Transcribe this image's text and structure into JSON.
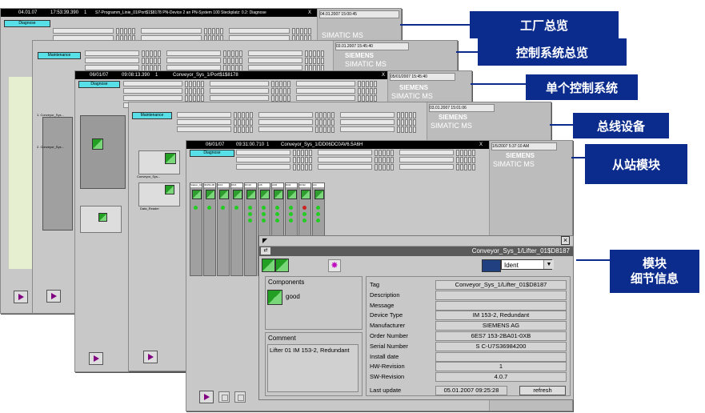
{
  "win1": {
    "titlebar": [
      "04.01.07",
      "17:53:39.390",
      "1",
      "S7-Programm_Linie_01/Port$1$8178 PN-Device 2 an PN-System 100 Steckplatz: 0.2: Diagnose",
      "X"
    ],
    "cyan_label": "Diagnose",
    "date": "04.01.2007 15:00:45",
    "simatic": "SIMATIC MS"
  },
  "win2": {
    "cyan_label": "Maintenance",
    "date": "03.01.2007 15:45:40",
    "siemens": "SIEMENS",
    "simatic": "SIMATIC MS",
    "module_labels": [
      "1. Conveyor_Sys...",
      "2. Conveyor_Sys..."
    ]
  },
  "win3": {
    "titlebar": [
      "06/01/07",
      "09:08:13.390",
      "1",
      "Conveyor_Sys_1/Port$1$8178",
      "X"
    ],
    "cyan_label": "Diagnose",
    "date": "05/01/2007 15:45:40",
    "siemens": "SIEMENS",
    "simatic": "SIMATIC MS",
    "labels": [
      "Conveyor_Sys...",
      "Data_Reader"
    ]
  },
  "win4": {
    "cyan_label": "Maintenance",
    "date": "03.01.2007 15:01:06",
    "siemens": "SIEMENS",
    "simatic": "SIMATIC MS"
  },
  "win5": {
    "titlebar": [
      "06/01/07",
      "09:31:00.710",
      "1",
      "Conveyor_Sys_1/DD06DC0AV6.5A6H",
      "X"
    ],
    "cyan_label": "Diagnose",
    "date": "1/5/2007 5:37:10 AM",
    "siemens": "SIEMENS",
    "simatic": "SIMATIC MS",
    "module_headers": [
      "Station_01",
      "IM153-2B",
      "DI16",
      "DI16",
      "DO16",
      "AI8",
      "AO8",
      "DI32",
      "DO32",
      "AI4"
    ]
  },
  "callouts": [
    "工厂总览",
    "控制系统总览",
    "单个控制系统",
    "总线设备",
    "从站模块",
    "模块\n细节信息"
  ],
  "detail": {
    "close": "×",
    "path": "Conveyor_Sys_1/Lifter_01$D8187",
    "view_select": "Ident",
    "components_label": "Components",
    "component_status": "good",
    "comment_label": "Comment",
    "comment_text": "Lifter 01  IM 153-2, Redundant",
    "fields": [
      {
        "k": "Tag",
        "v": "Conveyor_Sys_1/Lifter_01$D8187"
      },
      {
        "k": "Description",
        "v": ""
      },
      {
        "k": "Message",
        "v": ""
      },
      {
        "k": "Device Type",
        "v": "IM 153-2, Redundant"
      },
      {
        "k": "Manufacturer",
        "v": "SIEMENS AG"
      },
      {
        "k": "Order Number",
        "v": "6ES7 153-2BA01-0XB"
      },
      {
        "k": "Serial Number",
        "v": "S C-U7S36984200"
      },
      {
        "k": "Install date",
        "v": ""
      },
      {
        "k": "HW-Revision",
        "v": "1"
      },
      {
        "k": "SW-Revision",
        "v": "4.0.7"
      }
    ],
    "last_update_label": "Last update",
    "last_update_value": "05.01.2007 09:25:28",
    "refresh_label": "refresh"
  },
  "colors": {
    "callout_bg": "#0b2c8c",
    "status_green": "#22cc22",
    "diag_cyan": "#58e0e8"
  }
}
